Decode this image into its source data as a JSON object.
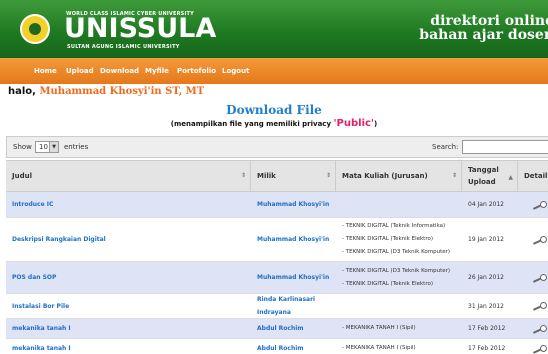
{
  "header": {
    "logo_top": "WORLD CLASS ISLAMIC CYBER UNIVERSITY",
    "logo_main": "UNISSULA",
    "logo_sub": "SULTAN AGUNG ISLAMIC UNIVERSITY",
    "right_line1": "direktori online",
    "right_line2": "bahan ajar dosen"
  },
  "nav": {
    "items": [
      "Home",
      "Upload",
      "Download",
      "Myfile",
      "Portofolio",
      "Logout"
    ]
  },
  "greeting": {
    "prefix": "halo, ",
    "name": "Muhammad Khosyi'in ST, MT"
  },
  "page": {
    "title": "Download File",
    "subtitle_prefix": "(menampilkan file yang memiliki privacy ",
    "subtitle_highlight": "'Public'",
    "subtitle_suffix": ")"
  },
  "controls": {
    "show_label": "Show",
    "show_value": "10",
    "entries_label": "entries",
    "search_label": "Search:"
  },
  "table": {
    "columns": [
      "Judul",
      "Milik",
      "Mata Kuliah (Jurusan)",
      "Tanggal Upload",
      "Detail"
    ],
    "rows": [
      {
        "title": "Introduce IC",
        "owner": "Muhammad Khosyi'in",
        "courses": [],
        "date": "04 Jan 2012"
      },
      {
        "title": "Deskripsi Rangkaian Digital",
        "owner": "Muhammad Khosyi'in",
        "courses": [
          "- TEKNIK DIGITAL (Teknik Informatika)",
          "- TEKNIK DIGITAL (Teknik Elektro)",
          "- TEKNIK DIGITAL (D3 Teknik Komputer)"
        ],
        "date": "19 Jan 2012"
      },
      {
        "title": "POS dan SOP",
        "owner": "Muhammad Khosyi'in",
        "courses": [
          "- TEKNIK DIGITAL (D3 Teknik Komputer)",
          "- TEKNIK DIGITAL (Teknik Elektro)"
        ],
        "date": "26 Jan 2012"
      },
      {
        "title": "Instalasi Bor Pile",
        "owner": "Rinda Karlinasari Indrayana",
        "courses": [],
        "date": "31 Jan 2012"
      },
      {
        "title": "mekanika tanah I",
        "owner": "Abdul Rochim",
        "courses": [
          "- MEKANIKA TANAH I (Sipil)"
        ],
        "date": "17 Feb 2012"
      },
      {
        "title": "mekanika tanah I",
        "owner": "Abdul Rochim",
        "courses": [
          "- MEKANIKA TANAH I (Sipil)"
        ],
        "date": "17 Feb 2012"
      }
    ]
  },
  "colors": {
    "header_green": "#1f7a22",
    "nav_orange": "#e5781a",
    "link_blue": "#1f6fc6",
    "name_orange": "#f26a1b",
    "public_pink": "#e0206a",
    "row_stripe": "#dfe3f6"
  },
  "icons": {
    "logo": "university-emblem-icon",
    "detail": "key-icon",
    "select_arrow": "caret-down-icon",
    "sort": "sort-arrows-icon"
  }
}
